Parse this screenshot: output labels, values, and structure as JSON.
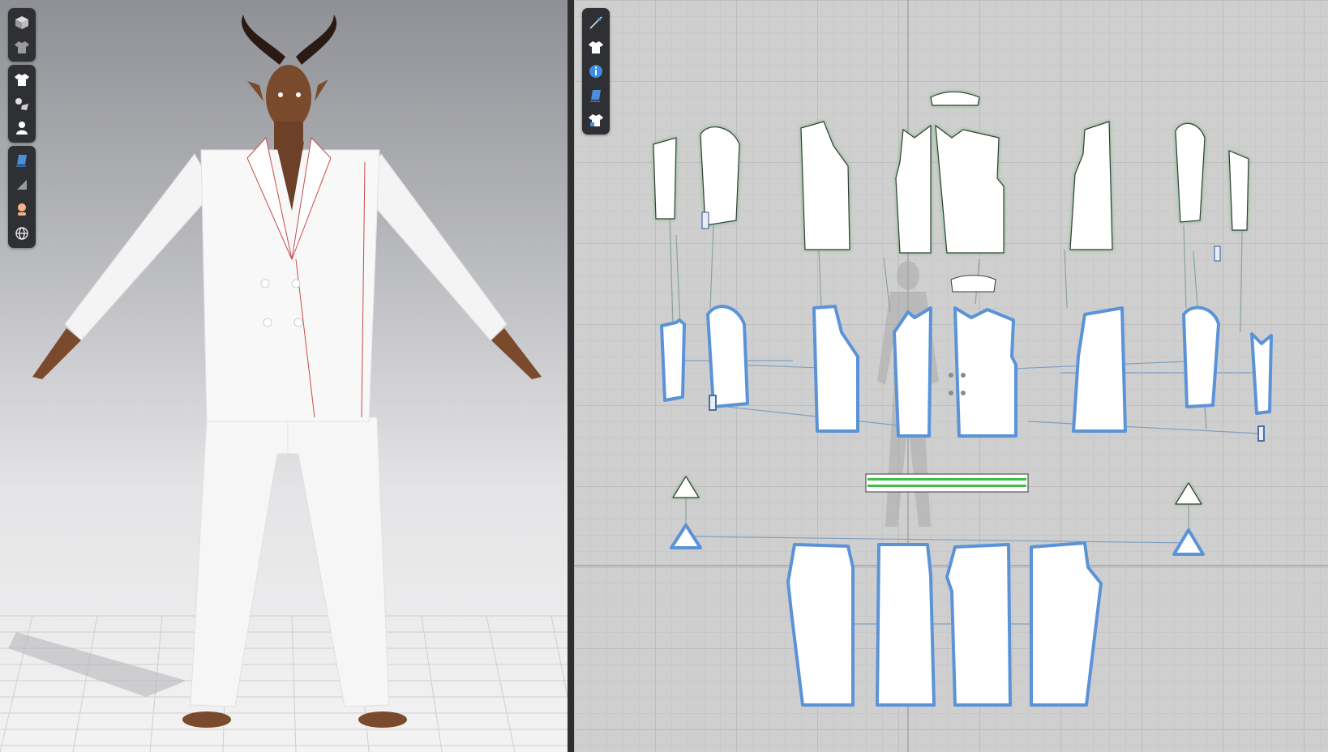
{
  "app": {
    "panes": [
      "3d-avatar-view",
      "2d-pattern-view"
    ],
    "accent_color": "#5b93d8",
    "garment_color": "#ffffff",
    "skin_color": "#7a4a2c"
  },
  "toolbar_3d": {
    "groups": [
      [
        "simulate-icon",
        "garment-display-icon"
      ],
      [
        "shirt-icon",
        "fabric-icon",
        "avatar-icon"
      ],
      [
        "brush-icon",
        "texture-icon",
        "avatar-head-icon",
        "globe-icon"
      ]
    ]
  },
  "toolbar_2d": {
    "items": [
      "segment-tool-icon",
      "shirt-icon",
      "info-icon",
      "fabric-tool-icon",
      "shirt-lock-icon"
    ]
  }
}
